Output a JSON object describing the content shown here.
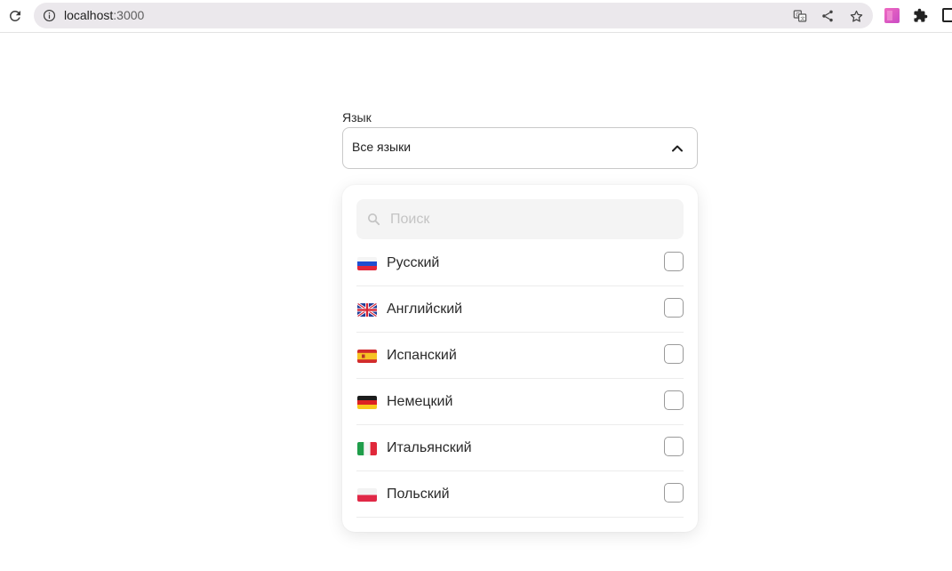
{
  "browser": {
    "url_host": "localhost",
    "url_port": ":3000",
    "icons": [
      "reload-icon",
      "site-info-icon",
      "translate-icon",
      "share-icon",
      "bookmark-star-icon",
      "extension-profile-icon",
      "extensions-puzzle-icon",
      "side-panel-icon"
    ]
  },
  "form": {
    "label": "Язык",
    "select_value": "Все языки",
    "search_placeholder": "Поиск",
    "languages": [
      {
        "label": "Русский",
        "flag": "ru-flag-icon",
        "checked": false
      },
      {
        "label": "Английский",
        "flag": "gb-flag-icon",
        "checked": false
      },
      {
        "label": "Испанский",
        "flag": "es-flag-icon",
        "checked": false
      },
      {
        "label": "Немецкий",
        "flag": "de-flag-icon",
        "checked": false
      },
      {
        "label": "Итальянский",
        "flag": "it-flag-icon",
        "checked": false
      },
      {
        "label": "Польский",
        "flag": "pl-flag-icon",
        "checked": false
      }
    ]
  },
  "colors": {
    "omnibox_bg": "#ebe8ec",
    "select_border": "#c9c9c9",
    "search_bg": "#f4f4f4",
    "checkbox_border": "#9a9a9a"
  }
}
